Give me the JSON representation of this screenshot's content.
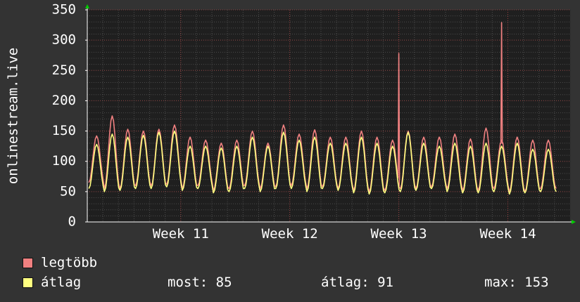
{
  "colors": {
    "background": "#333333",
    "plot_background": "#1f1f1f",
    "grid": "#6e6e6e",
    "grid_major": "#a04040",
    "max_series": "#f08080",
    "avg_series": "#ffff80",
    "axis_arrow": "#00cc00"
  },
  "chart_data": {
    "type": "line",
    "ylabel": "onlinestream.live",
    "ylim": [
      0,
      350
    ],
    "yticks": [
      0,
      50,
      100,
      150,
      200,
      250,
      300,
      350
    ],
    "x_range_days": [
      0,
      31
    ],
    "xticks": [
      {
        "label": "Week 11",
        "day": 6
      },
      {
        "label": "Week 12",
        "day": 13
      },
      {
        "label": "Week 13",
        "day": 20
      },
      {
        "label": "Week 14",
        "day": 27
      }
    ],
    "grid": true,
    "series": [
      {
        "name": "legtöbb",
        "color": "#f08080",
        "daily_peaks": [
          142,
          175,
          153,
          150,
          153,
          160,
          140,
          135,
          130,
          135,
          150,
          130,
          160,
          145,
          152,
          140,
          140,
          150,
          140,
          135,
          150,
          140,
          140,
          145,
          137,
          155,
          135,
          140,
          135,
          135
        ],
        "daily_lows": [
          65,
          55,
          55,
          60,
          58,
          62,
          55,
          60,
          52,
          55,
          60,
          55,
          58,
          60,
          55,
          58,
          55,
          52,
          50,
          52,
          55,
          55,
          58,
          55,
          52,
          52,
          55,
          50,
          50,
          55
        ],
        "spikes": [
          {
            "day": 20.0,
            "value": 278
          },
          {
            "day": 26.6,
            "value": 329
          }
        ]
      },
      {
        "name": "átlag",
        "color": "#ffff80",
        "daily_peaks": [
          128,
          145,
          140,
          143,
          148,
          150,
          125,
          125,
          122,
          125,
          140,
          125,
          148,
          135,
          140,
          130,
          130,
          140,
          130,
          125,
          148,
          130,
          125,
          130,
          125,
          130,
          125,
          130,
          120,
          120
        ],
        "daily_lows": [
          55,
          50,
          52,
          55,
          55,
          58,
          52,
          55,
          48,
          50,
          55,
          50,
          55,
          55,
          50,
          55,
          52,
          48,
          46,
          48,
          50,
          52,
          55,
          50,
          48,
          48,
          50,
          46,
          48,
          50
        ]
      }
    ],
    "stats": {
      "most_label": "most:",
      "most_value": "85",
      "atlag_label": "átlag:",
      "atlag_value": "91",
      "max_label": "max:",
      "max_value": "153"
    }
  },
  "legend": {
    "max_label": "legtöbb",
    "avg_label": "átlag"
  }
}
